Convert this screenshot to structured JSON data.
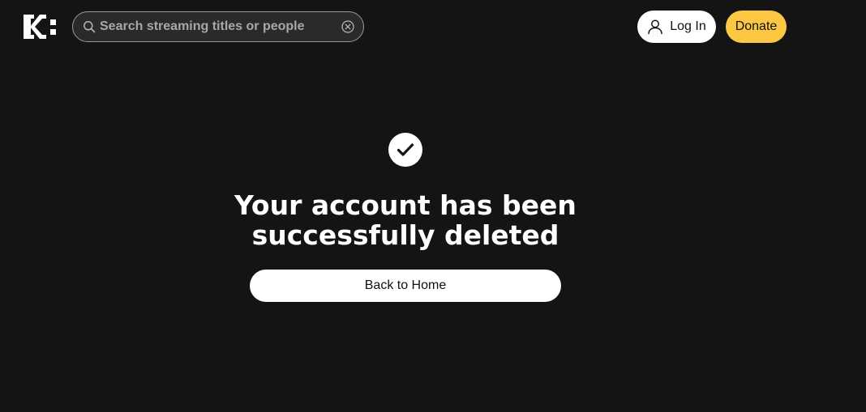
{
  "header": {
    "logo_text": "K:",
    "search": {
      "placeholder": "Search streaming titles or people",
      "value": ""
    },
    "login_label": "Log In",
    "donate_label": "Donate"
  },
  "main": {
    "headline_line1": "Your account has been",
    "headline_line2": "successfully deleted",
    "back_home_label": "Back to Home"
  },
  "colors": {
    "background": "#141414",
    "donate": "#fcc844",
    "button": "#ffffff"
  },
  "icons": {
    "search": "search-icon",
    "clear": "clear-icon",
    "user": "user-icon",
    "check": "check-icon"
  }
}
